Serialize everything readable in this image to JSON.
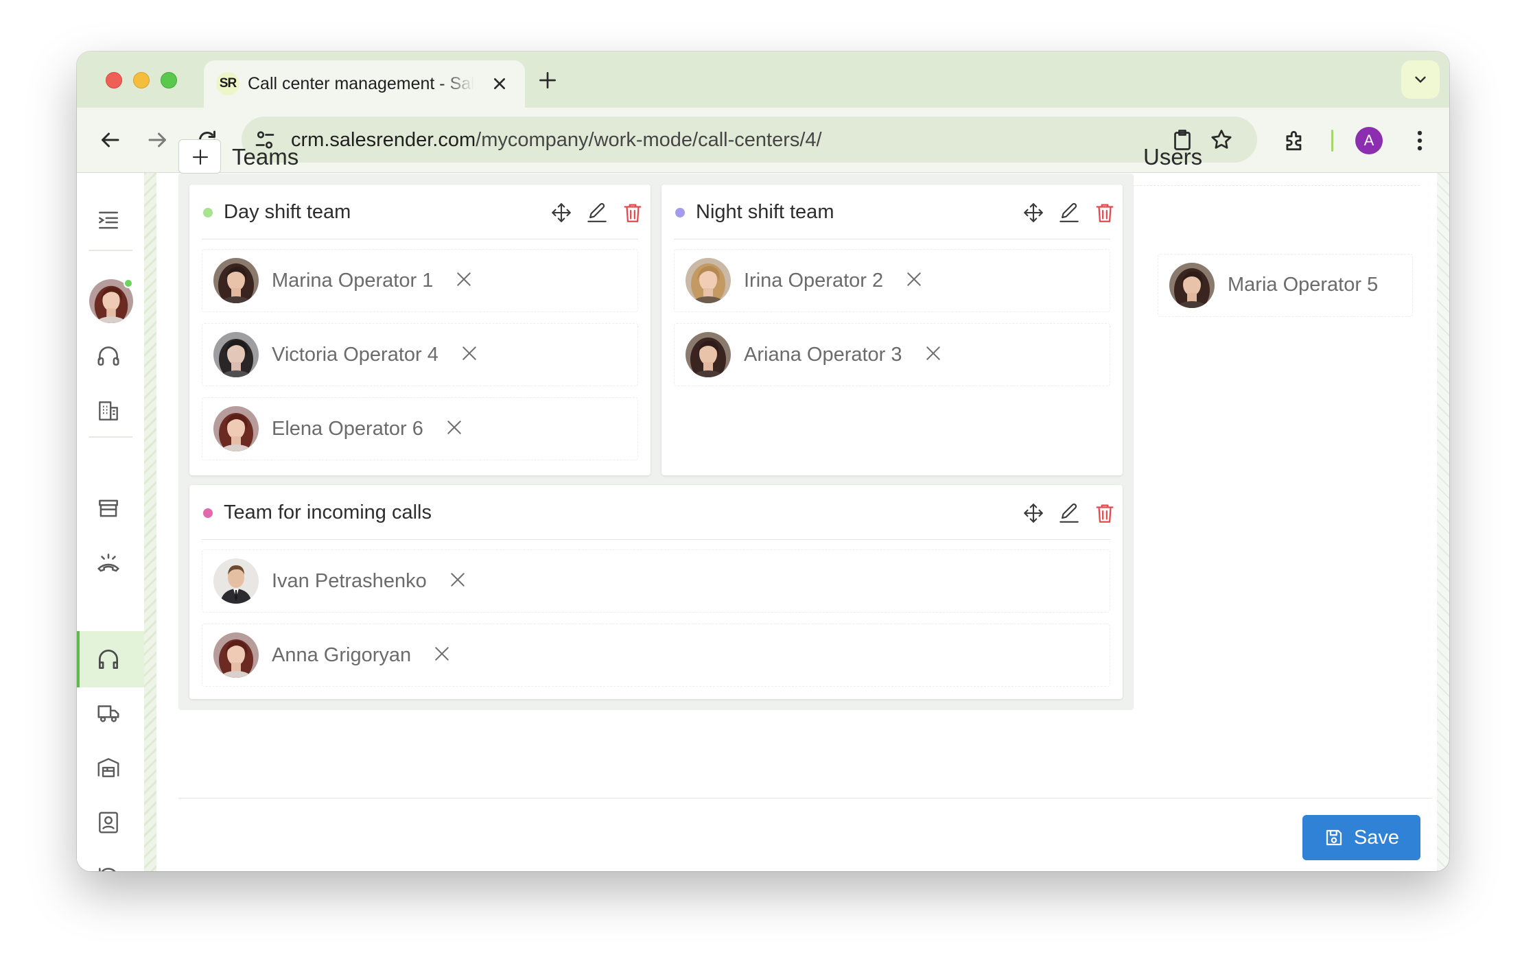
{
  "browser": {
    "tab_title": "Call center management - SalesRender",
    "tab_favicon": "SR",
    "url_domain": "crm.salesrender.com",
    "url_path": "/mycompany/work-mode/call-centers/4/",
    "profile_initial": "A",
    "icons": [
      "close-icon",
      "plus-icon",
      "chevron-down-icon",
      "back-arrow-icon",
      "forward-arrow-icon",
      "reload-icon",
      "tune-icon",
      "clipboard-icon",
      "star-icon",
      "extensions-icon",
      "kebab-menu-icon"
    ]
  },
  "sidebar": {
    "icons": [
      "menu-icon",
      "headset-icon",
      "building-icon",
      "store-icon",
      "phone-icon",
      "call-center-icon",
      "truck-icon",
      "warehouse-icon",
      "contact-card-icon",
      "history-icon"
    ],
    "active_item": "call-center-icon"
  },
  "teams_section": {
    "title": "Teams",
    "add_button_icon": "plus-icon",
    "teams": [
      {
        "name": "Day shift team",
        "color": "#a8e38f",
        "members": [
          "Marina Operator 1",
          "Victoria Operator 4",
          "Elena Operator 6"
        ]
      },
      {
        "name": "Night shift team",
        "color": "#a59bed",
        "members": [
          "Irina Operator 2",
          "Ariana Operator 3"
        ]
      },
      {
        "name": "Team for incoming calls",
        "color": "#e06aad",
        "members": [
          "Ivan Petrashenko",
          "Anna Grigoryan"
        ]
      }
    ]
  },
  "users_section": {
    "title": "Users",
    "users": [
      "Maria Operator 5"
    ]
  },
  "footer": {
    "save_label": "Save",
    "save_icon": "floppy-disk-icon"
  },
  "colors": {
    "accent_green": "#5fb94c",
    "save_blue": "#3082d6",
    "delete_red": "#e5484d"
  }
}
